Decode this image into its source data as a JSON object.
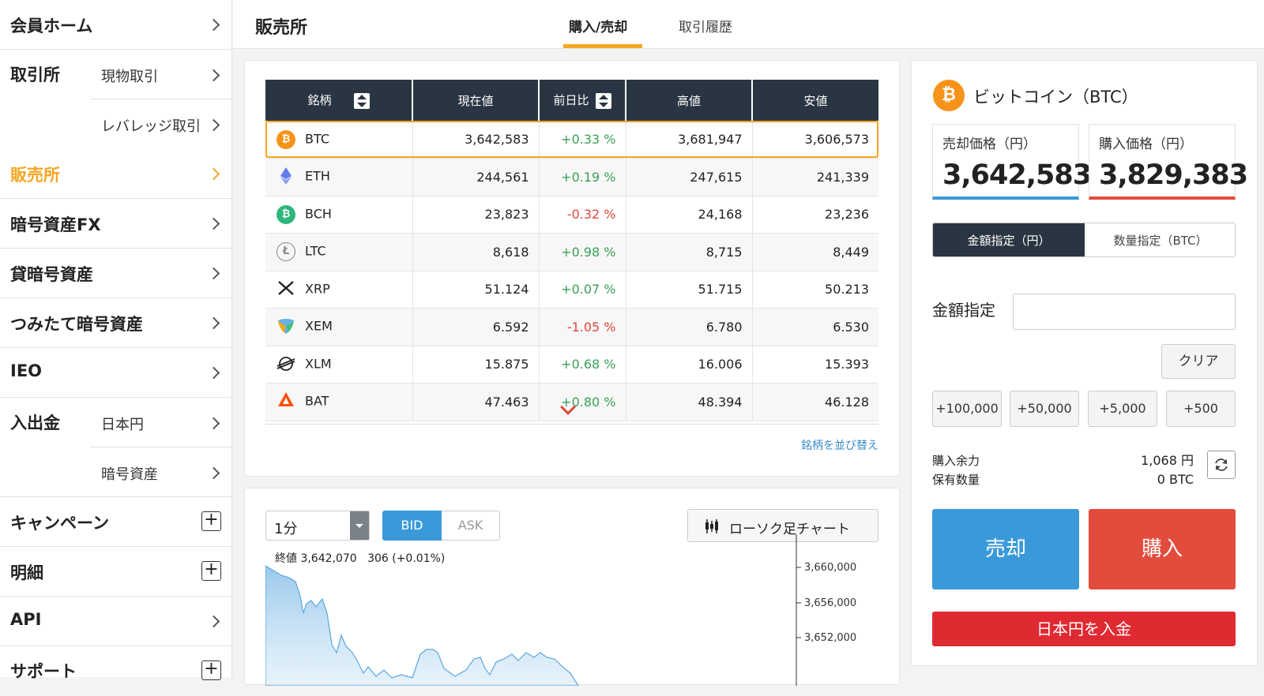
{
  "sidebar": {
    "items": [
      {
        "label": "会員ホーム",
        "control": "chevron"
      },
      {
        "label": "取引所",
        "subs": [
          "現物取引",
          "レバレッジ取引"
        ]
      },
      {
        "label": "販売所",
        "active": true,
        "control": "chevron"
      },
      {
        "label": "暗号資産FX",
        "control": "chevron"
      },
      {
        "label": "貸暗号資産",
        "control": "chevron"
      },
      {
        "label": "つみたて暗号資産",
        "control": "chevron"
      },
      {
        "label": "IEO",
        "control": "chevron"
      },
      {
        "label": "入出金",
        "subs": [
          "日本円",
          "暗号資産"
        ]
      },
      {
        "label": "キャンペーン",
        "control": "plus"
      },
      {
        "label": "明細",
        "control": "plus"
      },
      {
        "label": "API",
        "control": "chevron"
      },
      {
        "label": "サポート",
        "control": "plus"
      }
    ],
    "plus_glyph": "+"
  },
  "header": {
    "title": "販売所",
    "tabs": [
      {
        "label": "購入/売却",
        "active": true
      },
      {
        "label": "取引履歴",
        "active": false
      }
    ]
  },
  "market_table": {
    "columns": [
      "銘柄",
      "現在値",
      "前日比",
      "高値",
      "安値"
    ],
    "rows": [
      {
        "symbol": "BTC",
        "price": "3,642,583",
        "change": "+0.33 %",
        "high": "3,681,947",
        "low": "3,606,573",
        "dir": "up"
      },
      {
        "symbol": "ETH",
        "price": "244,561",
        "change": "+0.19 %",
        "high": "247,615",
        "low": "241,339",
        "dir": "up"
      },
      {
        "symbol": "BCH",
        "price": "23,823",
        "change": "-0.32 %",
        "high": "24,168",
        "low": "23,236",
        "dir": "down"
      },
      {
        "symbol": "LTC",
        "price": "8,618",
        "change": "+0.98 %",
        "high": "8,715",
        "low": "8,449",
        "dir": "up"
      },
      {
        "symbol": "XRP",
        "price": "51.124",
        "change": "+0.07 %",
        "high": "51.715",
        "low": "50.213",
        "dir": "up"
      },
      {
        "symbol": "XEM",
        "price": "6.592",
        "change": "-1.05 %",
        "high": "6.780",
        "low": "6.530",
        "dir": "down"
      },
      {
        "symbol": "XLM",
        "price": "15.875",
        "change": "+0.68 %",
        "high": "16.006",
        "low": "15.393",
        "dir": "up"
      },
      {
        "symbol": "BAT",
        "price": "47.463",
        "change": "+0.80 %",
        "high": "48.394",
        "low": "46.128",
        "dir": "up"
      }
    ],
    "sort_link": "銘柄を並び替え",
    "colors": {
      "up": "#3aa055",
      "down": "#e0463b",
      "header_bg": "#2a3543",
      "highlight": "#f5a623"
    }
  },
  "chart": {
    "interval": "1分",
    "bid_label": "BID",
    "ask_label": "ASK",
    "chart_type_button": "ローソク足チャート",
    "close_label": "終値 3,642,070",
    "change_label": "306 (+0.01%)",
    "y_ticks": [
      "3,660,000",
      "3,656,000",
      "3,652,000"
    ]
  },
  "order_panel": {
    "coin_title": "ビットコイン（BTC）",
    "sell_price_label": "売却価格（円）",
    "sell_price": "3,642,583",
    "buy_price_label": "購入価格（円）",
    "buy_price": "3,829,383",
    "mode_tabs": [
      "金額指定（円）",
      "数量指定（BTC）"
    ],
    "amount_label": "金額指定",
    "amount_value": "",
    "clear_button": "クリア",
    "quick_amounts": [
      "+100,000",
      "+50,000",
      "+5,000",
      "+500"
    ],
    "available_label": "購入余力",
    "available_value": "1,068 円",
    "holding_label": "保有数量",
    "holding_value": "0 BTC",
    "sell_button": "売却",
    "buy_button": "購入",
    "deposit_button": "日本円を入金",
    "colors": {
      "sell": "#3a9ad9",
      "buy": "#e24c3d",
      "deposit": "#e02a32"
    }
  }
}
